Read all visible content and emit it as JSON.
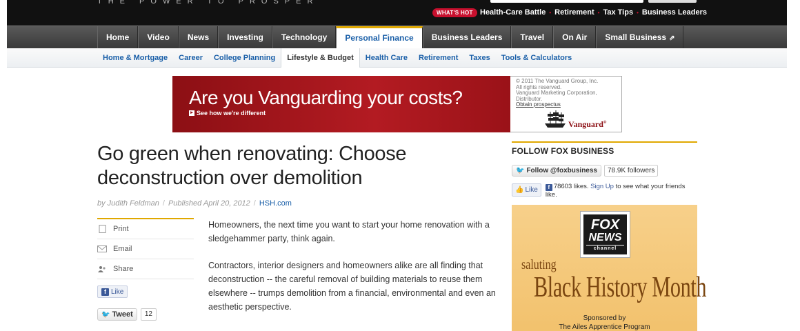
{
  "header": {
    "tagline": "THE POWER TO PROSPER",
    "tagline_tm": "™",
    "whats_hot": "WHAT'S HOT",
    "hot_links": [
      "Health-Care Battle",
      "Retirement",
      "Tax Tips",
      "Business Leaders"
    ]
  },
  "main_nav": [
    {
      "label": "Home"
    },
    {
      "label": "Video"
    },
    {
      "label": "News"
    },
    {
      "label": "Investing"
    },
    {
      "label": "Technology"
    },
    {
      "label": "Personal Finance",
      "active": true
    },
    {
      "label": "Business Leaders"
    },
    {
      "label": "Travel"
    },
    {
      "label": "On Air"
    },
    {
      "label": "Small Business",
      "external": "⇗"
    }
  ],
  "sub_nav": [
    {
      "label": "Home & Mortgage"
    },
    {
      "label": "Career"
    },
    {
      "label": "College Planning"
    },
    {
      "label": "Lifestyle & Budget",
      "active": true
    },
    {
      "label": "Health Care"
    },
    {
      "label": "Retirement"
    },
    {
      "label": "Taxes"
    },
    {
      "label": "Tools & Calculators"
    }
  ],
  "ad": {
    "headline": "Are you Vanguarding your costs?",
    "cta": "See how we're different",
    "legal_lines": [
      "© 2011 The Vanguard Group, Inc.",
      "All rights reserved.",
      "Vanguard Marketing Corporation,",
      "Distributor."
    ],
    "prospectus_link": "Obtain prospectus",
    "brand": "Vanguard",
    "brand_mark": "®"
  },
  "article": {
    "title": "Go green when renovating: Choose deconstruction over demolition",
    "byline_author": "by Judith Feldman",
    "byline_published": "Published April 20, 2012",
    "byline_source": "HSH.com",
    "paragraphs": [
      "Homeowners, the next time you want to start your home renovation with a sledgehammer party, think again.",
      "Contractors, interior designers and homeowners alike are all finding that deconstruction -- the careful removal of building materials to reuse them elsewhere -- trumps demolition from a financial, environmental and even an aesthetic perspective."
    ]
  },
  "share_tools": {
    "print": "Print",
    "email": "Email",
    "share": "Share",
    "fb_like": "Like",
    "tweet": "Tweet",
    "tweet_count": "12"
  },
  "sidebar": {
    "follow_title": "FOLLOW FOX BUSINESS",
    "twitter_button": "Follow @foxbusiness",
    "followers": "78.9K followers",
    "fb_like": "Like",
    "fb_text_count": "78603 likes.",
    "fb_signup": "Sign Up",
    "fb_text_rest": "to see what your friends like.",
    "promo": {
      "logo_line1": "FOX",
      "logo_line2": "NEWS",
      "logo_line3": "channel",
      "saluting": "saluting",
      "title": "Black History Month",
      "sponsored_line1": "Sponsored by",
      "sponsored_line2": "The Ailes Apprentice Program"
    }
  },
  "colors": {
    "accent_gold": "#e0a800",
    "link_blue": "#1a5fa8",
    "hot_red": "#c8102e",
    "vanguard_red": "#9a1218",
    "promo_bg": "#f2c16c"
  }
}
